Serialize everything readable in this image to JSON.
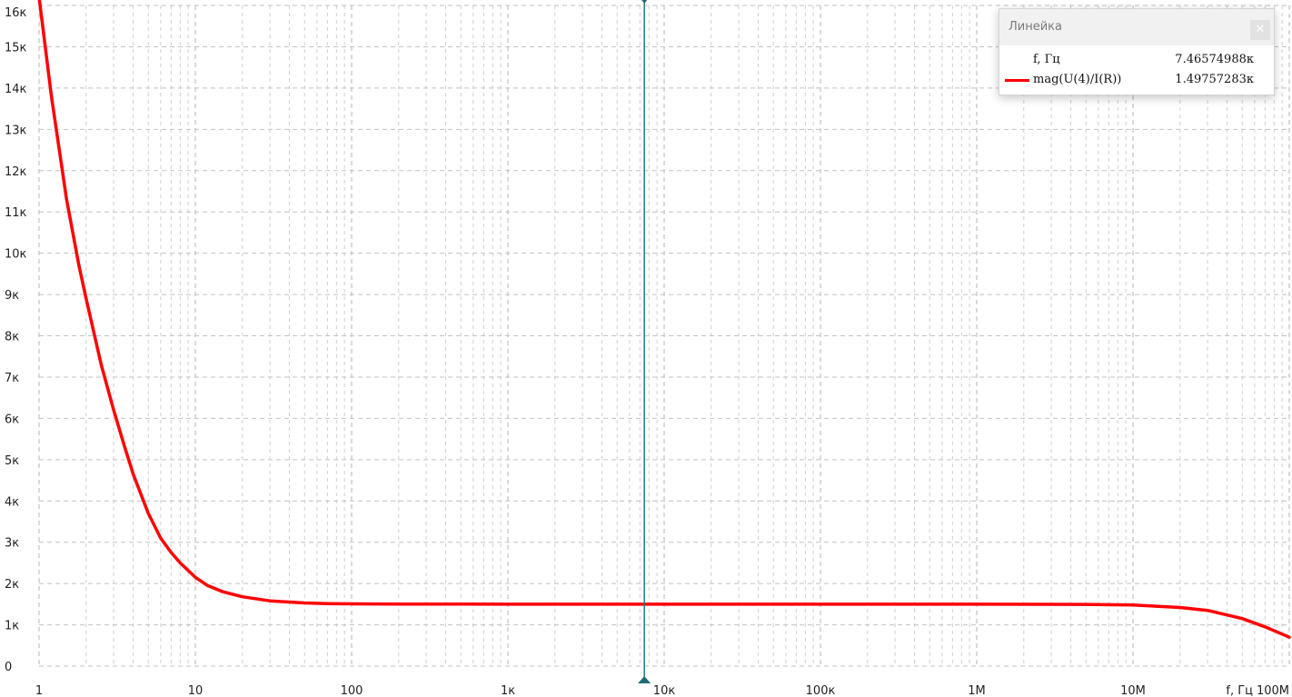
{
  "chart_data": {
    "type": "line",
    "xscale": "log",
    "xlim": [
      1,
      100000000
    ],
    "ylim": [
      0,
      16000
    ],
    "x_tick_labels": [
      "1",
      "10",
      "100",
      "1к",
      "10к",
      "100к",
      "1М",
      "10М",
      "100М"
    ],
    "x_axis_label": "f, Гц",
    "y_tick_labels": [
      "0",
      "1к",
      "2к",
      "3к",
      "4к",
      "5к",
      "6к",
      "7к",
      "8к",
      "9к",
      "10к",
      "11к",
      "12к",
      "13к",
      "14к",
      "15к",
      "16к"
    ],
    "grid": true,
    "cursor_x": 7465.74988,
    "series": [
      {
        "name": "mag(U(4)/I(R))",
        "color": "#ff0000",
        "x": [
          1,
          1.2,
          1.5,
          1.8,
          2,
          2.5,
          3,
          3.5,
          4,
          5,
          6,
          7,
          8,
          10,
          12,
          15,
          20,
          30,
          50,
          70,
          100,
          200,
          500,
          1000,
          10000,
          100000,
          1000000,
          5000000,
          10000000,
          20000000,
          30000000,
          50000000,
          70000000,
          100000000
        ],
        "y": [
          16200,
          13800,
          11300,
          9700,
          8900,
          7300,
          6200,
          5350,
          4650,
          3700,
          3100,
          2750,
          2500,
          2150,
          1950,
          1800,
          1680,
          1580,
          1530,
          1515,
          1508,
          1502,
          1500,
          1498,
          1498,
          1498,
          1498,
          1495,
          1480,
          1420,
          1350,
          1150,
          950,
          700
        ]
      }
    ]
  },
  "ruler": {
    "title": "Линейка",
    "close_icon": "close-icon",
    "x_label": "f, Гц",
    "x_value": "7.46574988к",
    "series_label": "mag(U(4)/I(R))",
    "series_value": "1.49757283к"
  }
}
